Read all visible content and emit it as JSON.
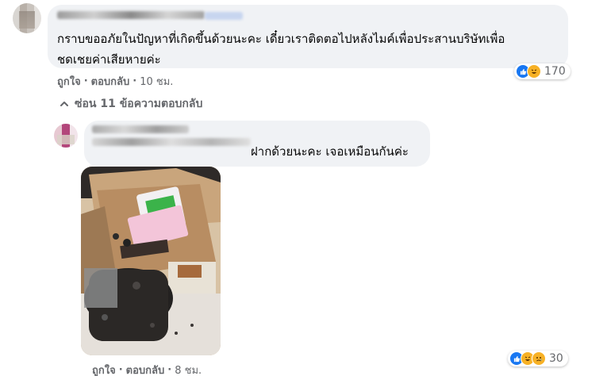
{
  "comment": {
    "text_line1": "กราบขออภัยในปัญหาที่เกิดขึ้นด้วยนะคะ เดี๋ยวเราติดตอไปหลังไมค์เพื่อประสานบริษัทเพื่อ",
    "text_line2": "ชดเชยค่าเสียหายค่ะ",
    "like_label": "ถูกใจ",
    "separator": "·",
    "reply_label": "ตอบกลับ",
    "time": "10 ชม.",
    "reaction_count": "170"
  },
  "hide_replies": {
    "label": "ซ่อน 11 ข้อความตอบกลับ"
  },
  "reply": {
    "text": "ฝากด้วยนะคะ เจอเหมือนกันค่ะ",
    "like_label": "ถูกใจ",
    "separator": "·",
    "reply_label": "ตอบกลับ",
    "time": "8 ชม.",
    "reaction_count": "30"
  },
  "icons": {
    "like": "like-reaction-icon",
    "haha": "haha-reaction-icon",
    "sad": "sad-reaction-icon",
    "chevron": "chevron-up-icon"
  },
  "colors": {
    "bubble": "#f0f2f5",
    "muted_text": "#65676b",
    "like_blue": "#1877f2",
    "emoji_yellow": "#f7b125"
  }
}
